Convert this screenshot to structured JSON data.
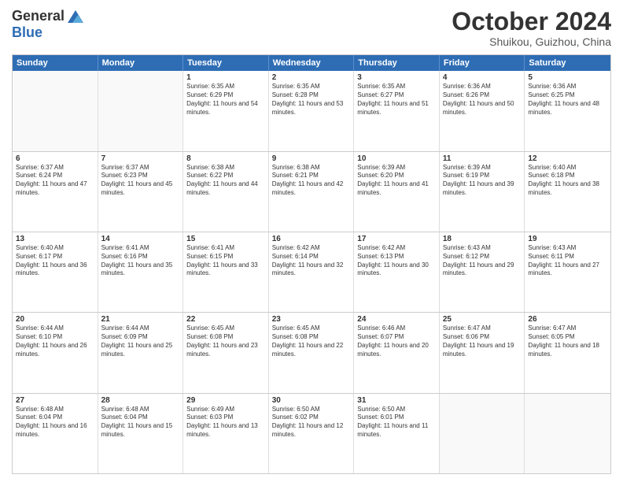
{
  "header": {
    "logo": {
      "general": "General",
      "blue": "Blue"
    },
    "title": "October 2024",
    "subtitle": "Shuikou, Guizhou, China"
  },
  "calendar": {
    "days": [
      "Sunday",
      "Monday",
      "Tuesday",
      "Wednesday",
      "Thursday",
      "Friday",
      "Saturday"
    ],
    "rows": [
      [
        {
          "day": "",
          "empty": true
        },
        {
          "day": "",
          "empty": true
        },
        {
          "day": "1",
          "rise": "6:35 AM",
          "set": "6:29 PM",
          "daylight": "11 hours and 54 minutes."
        },
        {
          "day": "2",
          "rise": "6:35 AM",
          "set": "6:28 PM",
          "daylight": "11 hours and 53 minutes."
        },
        {
          "day": "3",
          "rise": "6:35 AM",
          "set": "6:27 PM",
          "daylight": "11 hours and 51 minutes."
        },
        {
          "day": "4",
          "rise": "6:36 AM",
          "set": "6:26 PM",
          "daylight": "11 hours and 50 minutes."
        },
        {
          "day": "5",
          "rise": "6:36 AM",
          "set": "6:25 PM",
          "daylight": "11 hours and 48 minutes."
        }
      ],
      [
        {
          "day": "6",
          "rise": "6:37 AM",
          "set": "6:24 PM",
          "daylight": "11 hours and 47 minutes."
        },
        {
          "day": "7",
          "rise": "6:37 AM",
          "set": "6:23 PM",
          "daylight": "11 hours and 45 minutes."
        },
        {
          "day": "8",
          "rise": "6:38 AM",
          "set": "6:22 PM",
          "daylight": "11 hours and 44 minutes."
        },
        {
          "day": "9",
          "rise": "6:38 AM",
          "set": "6:21 PM",
          "daylight": "11 hours and 42 minutes."
        },
        {
          "day": "10",
          "rise": "6:39 AM",
          "set": "6:20 PM",
          "daylight": "11 hours and 41 minutes."
        },
        {
          "day": "11",
          "rise": "6:39 AM",
          "set": "6:19 PM",
          "daylight": "11 hours and 39 minutes."
        },
        {
          "day": "12",
          "rise": "6:40 AM",
          "set": "6:18 PM",
          "daylight": "11 hours and 38 minutes."
        }
      ],
      [
        {
          "day": "13",
          "rise": "6:40 AM",
          "set": "6:17 PM",
          "daylight": "11 hours and 36 minutes."
        },
        {
          "day": "14",
          "rise": "6:41 AM",
          "set": "6:16 PM",
          "daylight": "11 hours and 35 minutes."
        },
        {
          "day": "15",
          "rise": "6:41 AM",
          "set": "6:15 PM",
          "daylight": "11 hours and 33 minutes."
        },
        {
          "day": "16",
          "rise": "6:42 AM",
          "set": "6:14 PM",
          "daylight": "11 hours and 32 minutes."
        },
        {
          "day": "17",
          "rise": "6:42 AM",
          "set": "6:13 PM",
          "daylight": "11 hours and 30 minutes."
        },
        {
          "day": "18",
          "rise": "6:43 AM",
          "set": "6:12 PM",
          "daylight": "11 hours and 29 minutes."
        },
        {
          "day": "19",
          "rise": "6:43 AM",
          "set": "6:11 PM",
          "daylight": "11 hours and 27 minutes."
        }
      ],
      [
        {
          "day": "20",
          "rise": "6:44 AM",
          "set": "6:10 PM",
          "daylight": "11 hours and 26 minutes."
        },
        {
          "day": "21",
          "rise": "6:44 AM",
          "set": "6:09 PM",
          "daylight": "11 hours and 25 minutes."
        },
        {
          "day": "22",
          "rise": "6:45 AM",
          "set": "6:08 PM",
          "daylight": "11 hours and 23 minutes."
        },
        {
          "day": "23",
          "rise": "6:45 AM",
          "set": "6:08 PM",
          "daylight": "11 hours and 22 minutes."
        },
        {
          "day": "24",
          "rise": "6:46 AM",
          "set": "6:07 PM",
          "daylight": "11 hours and 20 minutes."
        },
        {
          "day": "25",
          "rise": "6:47 AM",
          "set": "6:06 PM",
          "daylight": "11 hours and 19 minutes."
        },
        {
          "day": "26",
          "rise": "6:47 AM",
          "set": "6:05 PM",
          "daylight": "11 hours and 18 minutes."
        }
      ],
      [
        {
          "day": "27",
          "rise": "6:48 AM",
          "set": "6:04 PM",
          "daylight": "11 hours and 16 minutes."
        },
        {
          "day": "28",
          "rise": "6:48 AM",
          "set": "6:04 PM",
          "daylight": "11 hours and 15 minutes."
        },
        {
          "day": "29",
          "rise": "6:49 AM",
          "set": "6:03 PM",
          "daylight": "11 hours and 13 minutes."
        },
        {
          "day": "30",
          "rise": "6:50 AM",
          "set": "6:02 PM",
          "daylight": "11 hours and 12 minutes."
        },
        {
          "day": "31",
          "rise": "6:50 AM",
          "set": "6:01 PM",
          "daylight": "11 hours and 11 minutes."
        },
        {
          "day": "",
          "empty": true
        },
        {
          "day": "",
          "empty": true
        }
      ]
    ]
  }
}
